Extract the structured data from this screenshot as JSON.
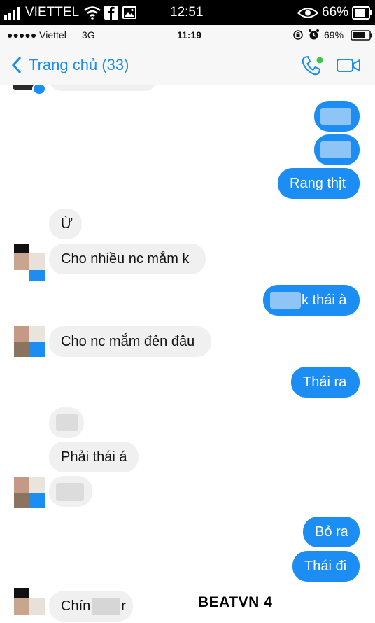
{
  "outer_status": {
    "carrier": "VIETTEL",
    "time": "12:51",
    "battery": "66%",
    "icons": [
      "signal-icon",
      "wifi-icon",
      "facebook-icon",
      "gallery-icon",
      "eye-icon",
      "battery-icon"
    ]
  },
  "inner_status": {
    "carrier": "●●●●● Viettel",
    "network": "3G",
    "time": "11:19",
    "battery": "69%",
    "icons": [
      "lock-rotation-icon",
      "alarm-icon",
      "battery-icon"
    ]
  },
  "navbar": {
    "back_label": "Trang chủ (33)",
    "accent_color": "#1c8df2",
    "icons": [
      "back-chevron-icon",
      "call-icon",
      "video-icon"
    ]
  },
  "messages": {
    "m1": "Rang thịt",
    "m2": "Ừ",
    "m3": "Cho nhiều nc mắm k",
    "m4": "k thái à",
    "m5": "Cho nc mắm đên đâu",
    "m6": "Thái ra",
    "m7": "Phải thái á",
    "m8": "Bỏ ra",
    "m9": "Thái đi",
    "m10a": "Chín",
    "m10b": "r"
  },
  "watermark": "BEATVN 4",
  "colors": {
    "outgoing_bubble": "#1c8df2",
    "incoming_bubble": "#f0f0f0"
  }
}
